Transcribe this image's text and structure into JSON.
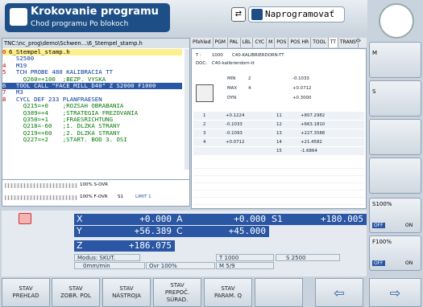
{
  "header": {
    "mode_title": "Krokovanie programu",
    "mode_sub": "Chod programu Po blokoch",
    "prog_mode": "Naprogramovať"
  },
  "program": {
    "path": "TNC:\\nc_prog\\demo\\Schwen…\\6_Stempel_stamp.h",
    "lines": [
      {
        "n": "0",
        "t": "6_Stempel_stamp.h",
        "cls": "cur"
      },
      {
        "n": "",
        "t": "  S2500",
        "cls": ""
      },
      {
        "n": "4",
        "t": "  M19",
        "cls": ""
      },
      {
        "n": "5",
        "t": "  TCH PROBE 480 KALIBRACIA TT",
        "cls": ""
      },
      {
        "n": "",
        "t": "    Q260=+100  ;BEZP. VYSKA",
        "cls": ""
      },
      {
        "n": "6",
        "t": "  TOOL CALL \"FACE_MILL_D40\" Z S2000 F1000",
        "cls": "sel"
      },
      {
        "n": "7",
        "t": "  M3",
        "cls": ""
      },
      {
        "n": "8",
        "t": "  CYCL DEF 233 PLANFRAESEN",
        "cls": ""
      },
      {
        "n": "",
        "t": "    Q215=+0    ;ROZSAH OBRABANIA",
        "cls": ""
      },
      {
        "n": "",
        "t": "    Q389=+4    ;STRATEGIA FREZOVANIA",
        "cls": ""
      },
      {
        "n": "",
        "t": "    Q350=+1    ;FRAESRICHTUNG",
        "cls": ""
      },
      {
        "n": "",
        "t": "    Q218=-60   ;1. DLZKA STRANY",
        "cls": ""
      },
      {
        "n": "",
        "t": "    Q219=+60   ;2. DLZKA STRANY",
        "cls": ""
      },
      {
        "n": "",
        "t": "    Q227=+2    ;START. BOD 3. OSI",
        "cls": ""
      }
    ]
  },
  "tabs": [
    "Přehled",
    "PGM",
    "PAL",
    "LBL",
    "CYC",
    "M",
    "POS",
    "POS HR",
    "TOOL",
    "TT",
    "TRANS"
  ],
  "tt": {
    "t_label": "T :",
    "t_num": "1000",
    "t_name": "C40-KALIBRIERDORN-TT",
    "doc_label": "DOC:",
    "doc": "C40-kalibrierdorn-tt",
    "min": [
      "MIN",
      "2",
      "-0.1033"
    ],
    "max": [
      "MAX",
      "4",
      "+0.0712"
    ],
    "dyn": [
      "DYN",
      "",
      "+0.3000"
    ],
    "rows": [
      [
        "1",
        "+0.1224",
        "11",
        "+807.2982"
      ],
      [
        "2",
        "-0.1033",
        "12",
        "+663.1810"
      ],
      [
        "3",
        "-0.1093",
        "13",
        "+227.3588"
      ],
      [
        "4",
        "+0.0712",
        "14",
        "+21.4582"
      ],
      [
        "",
        "",
        "15",
        "-1.6864"
      ]
    ]
  },
  "override": {
    "s": "100% S-OVR",
    "f": "100% F-OVR",
    "s1": "S1",
    "limit": "LIMIT 1"
  },
  "pos": {
    "x_lbl": "X",
    "x": "+0.000",
    "a_lbl": "A",
    "a": "+0.000",
    "s1_lbl": "S1",
    "s1": "+180.005",
    "y_lbl": "Y",
    "y": "+56.389",
    "c_lbl": "C",
    "c": "+45.000",
    "z_lbl": "Z",
    "z": "+186.075"
  },
  "status": {
    "modus": "Modus: SKUT.",
    "t": "T 1000",
    "s": "S 2500",
    "feed": "0mm/min",
    "ovr": "Ovr 100%",
    "m": "M 5/9"
  },
  "side": {
    "s_ovr": "S100%",
    "f_ovr": "F100%",
    "off": "OFF",
    "on": "ON"
  },
  "softkeys": [
    "STAV\nPREHĽAD",
    "STAV\nZOBR. POL",
    "STAV\nNÁSTROJA",
    "STAV\nPREPOČ.\nSÚRAD.",
    "STAV\nPARAM. Q",
    "",
    ""
  ]
}
